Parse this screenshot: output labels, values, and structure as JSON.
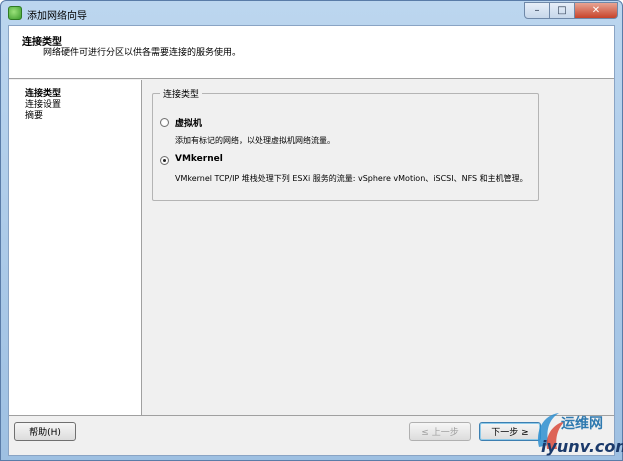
{
  "window": {
    "title": "添加网络向导",
    "controls": {
      "minimize": "–",
      "maximize": "□",
      "close": "✕"
    }
  },
  "header": {
    "title": "连接类型",
    "description": "网络硬件可进行分区以供各需要连接的服务使用。"
  },
  "nav": {
    "items": [
      {
        "label": "连接类型",
        "active": true
      },
      {
        "label": "连接设置",
        "active": false
      },
      {
        "label": "摘要",
        "active": false
      }
    ]
  },
  "group": {
    "legend": "连接类型",
    "options": [
      {
        "label": "虚拟机",
        "description": "添加有标记的网络，以处理虚拟机网络流量。",
        "checked": false
      },
      {
        "label": "VMkernel",
        "description": "VMkernel TCP/IP 堆栈处理下列 ESXi 服务的流量: vSphere vMotion、iSCSI、NFS 和主机管理。",
        "checked": true
      }
    ]
  },
  "footer": {
    "help_label": "帮助(H)",
    "back_label": "≤ 上一步",
    "next_label": "下一步 ≥"
  },
  "watermark": {
    "cn": "运维网",
    "en": "iyunv.com"
  }
}
